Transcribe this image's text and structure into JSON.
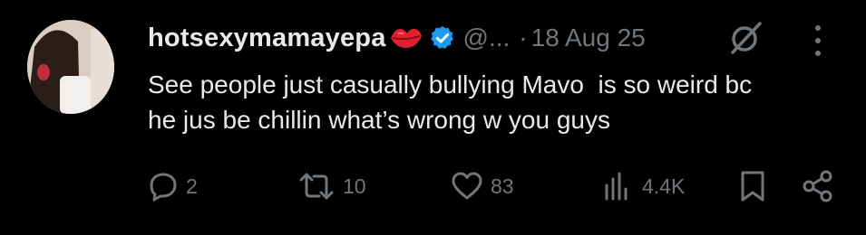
{
  "author": {
    "display_name": "hotsexymamayepa",
    "handle": "@...",
    "verified": true,
    "emoji_icon": "lips-kiss-icon"
  },
  "separator": "·",
  "date": "18 Aug 25",
  "text": "See people just casually bullying Mavo  is so weird bc\nhe jus be chillin what’s wrong w you guys",
  "actions": {
    "replies": "2",
    "reposts": "10",
    "likes": "83",
    "views": "4.4K"
  },
  "colors": {
    "background": "#000000",
    "primary_text": "#e7e9ea",
    "secondary_text": "#71767b",
    "verified_blue": "#1d9bf0",
    "lips_red": "#e0202e"
  }
}
